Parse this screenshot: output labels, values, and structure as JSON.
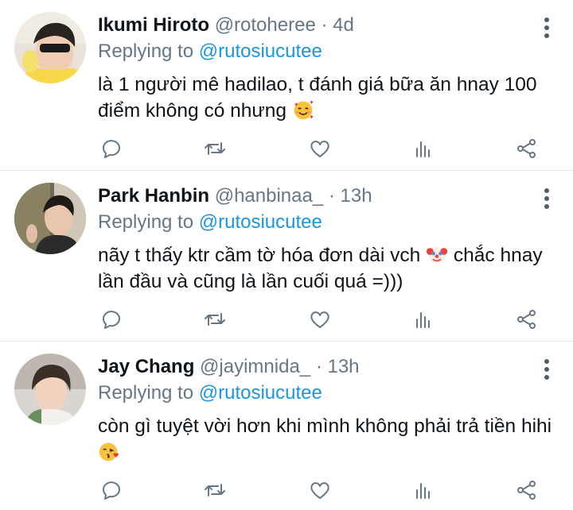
{
  "tweets": [
    {
      "name": "Ikumi Hiroto",
      "handle": "@rotoheree",
      "dot": "·",
      "time": "4d",
      "reply_prefix": "Replying to",
      "reply_mention": "@rutosiucutee",
      "text": "là 1 người mê hadilao, t đánh giá bữa ăn hnay 100 điểm không có nhưng",
      "emoji": "smiling-face-with-hearts-emoji"
    },
    {
      "name": "Park Hanbin",
      "handle": "@hanbinaa_",
      "dot": "·",
      "time": "13h",
      "reply_prefix": "Replying to",
      "reply_mention": "@rutosiucutee",
      "text_a": "nãy t thấy ktr cầm tờ hóa đơn dài vch",
      "text_b": "chắc hnay lần đầu và cũng là lần cuối quá =)))",
      "emoji": "clown-face-emoji"
    },
    {
      "name": "Jay Chang",
      "handle": "@jayimnida_",
      "dot": "·",
      "time": "13h",
      "reply_prefix": "Replying to",
      "reply_mention": "@rutosiucutee",
      "text": "còn gì tuyệt vời hơn khi mình không phải trả tiền hihi",
      "emoji": "face-blowing-kiss-emoji"
    }
  ],
  "actions": [
    "reply-icon",
    "retweet-icon",
    "like-icon",
    "analytics-icon",
    "share-icon"
  ],
  "colors": {
    "text": "#0f1419",
    "muted": "#657786",
    "mention": "#1b95e0",
    "separator": "#e1e8ed"
  }
}
